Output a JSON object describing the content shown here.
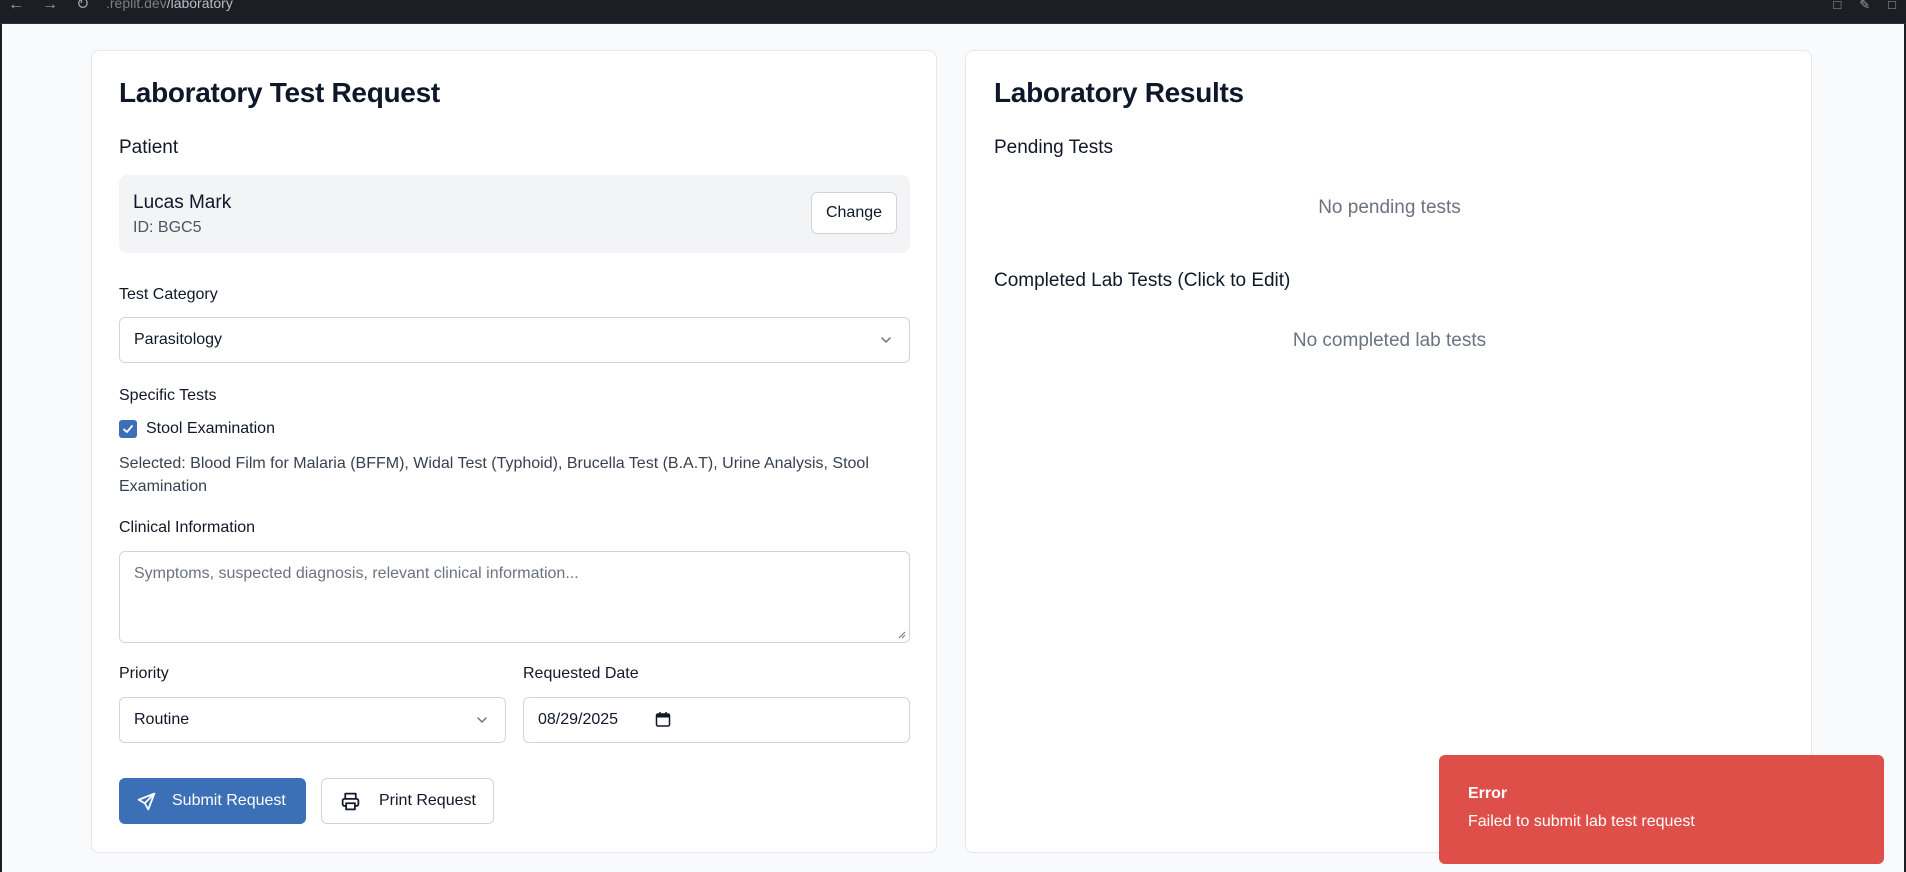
{
  "browser": {
    "url_prefix": ".replit.dev",
    "url_path": "/laboratory"
  },
  "request_form": {
    "title": "Laboratory Test Request",
    "patient_label": "Patient",
    "patient": {
      "name": "Lucas Mark",
      "id": "ID: BGC5",
      "change_label": "Change"
    },
    "test_category_label": "Test Category",
    "test_category_value": "Parasitology",
    "specific_tests_label": "Specific Tests",
    "tests": [
      {
        "label": "Stool Examination",
        "checked": true
      }
    ],
    "selected_summary": "Selected: Blood Film for Malaria (BFFM), Widal Test (Typhoid), Brucella Test (B.A.T), Urine Analysis, Stool Examination",
    "clinical_info_label": "Clinical Information",
    "clinical_info_placeholder": "Symptoms, suspected diagnosis, relevant clinical information...",
    "priority_label": "Priority",
    "priority_value": "Routine",
    "requested_date_label": "Requested Date",
    "requested_date_value": "08/29/2025",
    "submit_label": "Submit Request",
    "print_label": "Print Request"
  },
  "results": {
    "title": "Laboratory Results",
    "pending_label": "Pending Tests",
    "pending_empty": "No pending tests",
    "completed_label": "Completed Lab Tests (Click to Edit)",
    "completed_empty": "No completed lab tests"
  },
  "toast": {
    "title": "Error",
    "message": "Failed to submit lab test request",
    "color": "#df4f4a"
  },
  "colors": {
    "primary": "#3b6fb6",
    "page_bg": "#f8fafc"
  }
}
